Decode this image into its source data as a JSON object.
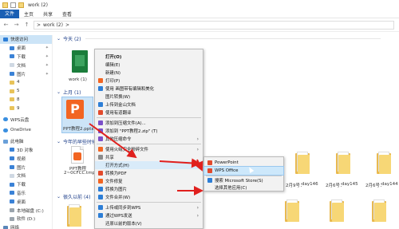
{
  "window": {
    "title": "work (2)"
  },
  "ribbon": {
    "file": "文件",
    "tabs": [
      "主页",
      "共享",
      "查看"
    ]
  },
  "address": {
    "path_root": ">",
    "path": "work (2)",
    "chevron": ">"
  },
  "sidebar": {
    "items": [
      {
        "label": "快速访问",
        "icon": "star-icon",
        "active": true
      },
      {
        "label": "桌面",
        "icon": "desktop-icon",
        "pin": true
      },
      {
        "label": "下载",
        "icon": "download-icon",
        "pin": true
      },
      {
        "label": "文档",
        "icon": "document-icon",
        "pin": true
      },
      {
        "label": "图片",
        "icon": "picture-icon",
        "pin": true
      },
      {
        "label": "4",
        "icon": "folder-icon"
      },
      {
        "label": "5",
        "icon": "folder-icon"
      },
      {
        "label": "8",
        "icon": "folder-icon"
      },
      {
        "label": "9",
        "icon": "folder-icon"
      },
      {
        "label": "WPS云盘",
        "icon": "cloud-icon"
      },
      {
        "label": "OneDrive",
        "icon": "cloud-icon"
      },
      {
        "label": "此电脑",
        "icon": "computer-icon"
      },
      {
        "label": "3D 对象",
        "icon": "cube-icon"
      },
      {
        "label": "视频",
        "icon": "video-icon"
      },
      {
        "label": "图片",
        "icon": "picture-icon"
      },
      {
        "label": "文档",
        "icon": "document-icon"
      },
      {
        "label": "下载",
        "icon": "download-icon"
      },
      {
        "label": "音乐",
        "icon": "music-icon"
      },
      {
        "label": "桌面",
        "icon": "desktop-icon"
      },
      {
        "label": "本地磁盘 (C:)",
        "icon": "drive-icon"
      },
      {
        "label": "软件 (D:)",
        "icon": "drive-icon"
      },
      {
        "label": "网络",
        "icon": "network-icon"
      }
    ]
  },
  "groups": {
    "today": "今天 (2)",
    "last_month": "上月 (1)",
    "earlier_this_year": "今年的早些时候",
    "long_ago": "很久以前 (4)"
  },
  "files": {
    "work1": "work (1)",
    "ppt_selected": "PPT教程2.pptx",
    "ppt_other_line1": "PPT教程",
    "ppt_other_line2": "2~0CFCC.tmp"
  },
  "right_labels": [
    "2月9号：",
    "2月6号：",
    "day146",
    "2月6号：",
    "day145",
    "2月6号：",
    "day144"
  ],
  "context_menu": {
    "items": [
      {
        "label": "打开(O)",
        "bold": true
      },
      {
        "label": "编辑(E)"
      },
      {
        "label": "新建(N)"
      },
      {
        "label": "打印(P)"
      },
      {
        "label": "使用 画图带有编辑和美化"
      },
      {
        "label": "图片转换(W)"
      },
      {
        "label": "上传到金山文档"
      },
      {
        "label": "使用有道翻译"
      },
      {
        "label": "添加到压缩文件(A)..."
      },
      {
        "label": "添加到 \"PPT教程2.zip\" (T)"
      },
      {
        "label": "其他压缩命令",
        "submenu": true
      },
      {
        "label": "使用火绒安全粉碎文件",
        "submenu": true
      },
      {
        "label": "共享"
      },
      {
        "label": "打开方式(H)",
        "submenu": true,
        "highlight": true
      },
      {
        "label": "转换为PDF"
      },
      {
        "label": "文件修复"
      },
      {
        "label": "转换为图片"
      },
      {
        "label": "文件合并(W)"
      },
      {
        "label": "上传或同步到WPS",
        "submenu": true
      },
      {
        "label": "通过WPS发送",
        "submenu": true
      },
      {
        "label": "还原以前的版本(V)"
      },
      {
        "label": "添加到压缩文件(A)..."
      }
    ]
  },
  "submenu": {
    "items": [
      {
        "label": "PowerPoint"
      },
      {
        "label": "WPS Office",
        "highlight": true
      },
      {
        "label": "搜索 Microsoft Store(S)"
      },
      {
        "label": "选择其他应用(C)"
      }
    ]
  },
  "colors": {
    "accent": "#1a5fb4",
    "arrow": "#e0201e",
    "folder": "#f7d776",
    "selection": "#cce4f7"
  }
}
